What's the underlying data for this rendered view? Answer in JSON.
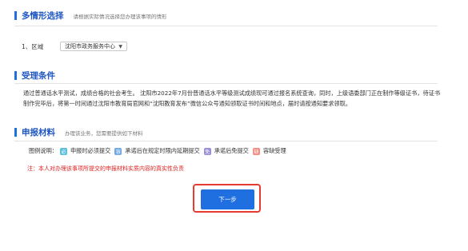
{
  "scenario": {
    "title": "多情形选择",
    "hint": "请根据实际情况选择您办理该事项的情形",
    "region_label": "1、区域",
    "region_value": "沈阳市政务服务中心"
  },
  "conditions": {
    "title": "受理条件",
    "text": "通过普通话水平测试，成绩合格的社会考生。 沈阳市2022年7月份普通话水平等级测试成绩现可通过报名系统查询，同时，上级语委部门正在制作等级证书，待证书制作完毕后，将第一时间通过沈阳市教育局官网和“沈阳教育发布”微信公众号通知领取证书时间和地点，届时请按通知要求领取。"
  },
  "materials": {
    "title": "申报材料",
    "hint": "办理该业务，您需要提供如下材料",
    "legend_label": "图例说明：",
    "legend": [
      {
        "icon": "必",
        "label": "申报时必须提交",
        "color": "#5bc0de"
      },
      {
        "icon": "容",
        "label": "承诺后在规定时限内延期提交",
        "color": "#6fa8e6"
      },
      {
        "icon": "免",
        "label": "承诺后免提交",
        "color": "#9a8fd6"
      },
      {
        "icon": "缺",
        "label": "容缺受理",
        "color": "#f28b82"
      }
    ],
    "notice": "注：本人对办理该事项所提交的申报材料实质内容的真实性负责"
  },
  "actions": {
    "next_label": "下一步"
  }
}
